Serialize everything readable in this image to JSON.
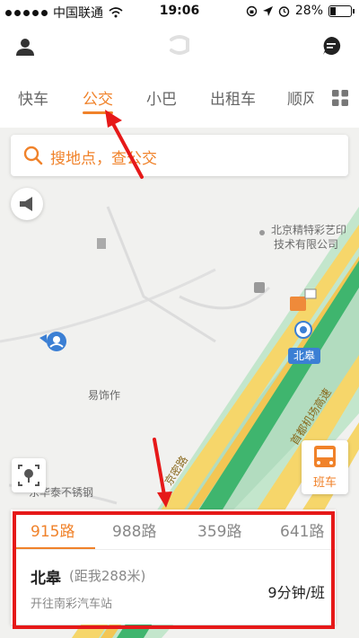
{
  "status_bar": {
    "carrier": "中国联通",
    "time": "19:06",
    "battery": "28%",
    "battery_level": 0.28
  },
  "header": {
    "tabs": [
      {
        "label": "快车"
      },
      {
        "label": "公交",
        "active": true
      },
      {
        "label": "小巴"
      },
      {
        "label": "出租车"
      },
      {
        "label": "顺风"
      }
    ]
  },
  "search": {
    "placeholder": "搜地点，查公交"
  },
  "map": {
    "pois": [
      "北京精特彩艺印",
      "技术有限公司",
      "易饰作",
      "东华泰不锈钢"
    ],
    "station": "北皋",
    "roads": [
      "京密路",
      "首都机场高速"
    ]
  },
  "bus_button": {
    "label": "班车"
  },
  "bottom_card": {
    "routes": [
      "915路",
      "988路",
      "359路",
      "641路"
    ],
    "active_route": "915路",
    "stop_name": "北皋",
    "stop_distance": "(距我288米)",
    "direction": "开往南彩汽车站",
    "frequency": "9分钟/班"
  },
  "colors": {
    "accent": "#f0822a",
    "annotation_red": "#e61919",
    "map_green": "#b9dfc4",
    "road_yellow": "#f6d66a"
  }
}
